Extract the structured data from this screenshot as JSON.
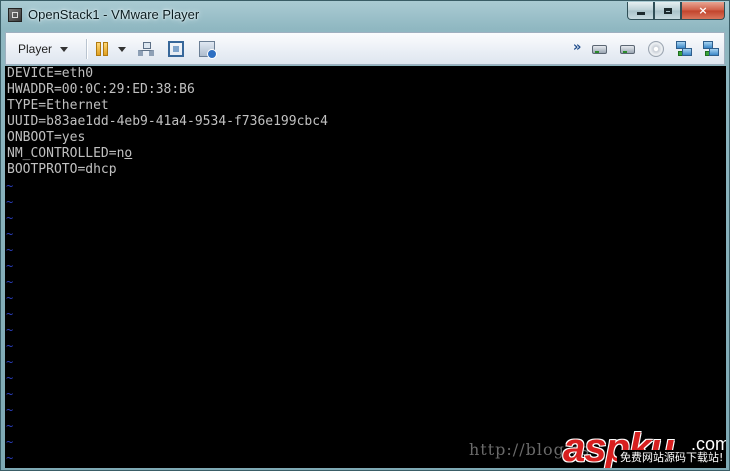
{
  "window": {
    "title": "OpenStack1 - VMware Player",
    "app_icon": "vmware-player-icon",
    "controls": {
      "minimize": "minimize-icon",
      "maximize": "maximize-icon",
      "close": "×"
    }
  },
  "toolbar": {
    "player_menu_label": "Player",
    "more_chevron": "»",
    "icons": [
      "pause-icon",
      "network-icon",
      "fullscreen-icon",
      "unity-icon",
      "hard-disk-icon",
      "hard-disk-icon",
      "cd-dvd-icon",
      "network-adapter-icon",
      "network-adapter-icon"
    ]
  },
  "console": {
    "text_color": "#c0c0c0",
    "tilde_color": "#2a3fbf",
    "lines": [
      "DEVICE=eth0",
      "HWADDR=00:0C:29:ED:38:B6",
      "TYPE=Ethernet",
      "UUID=b83ae1dd-4eb9-41a4-9534-f736e199cbc4",
      "ONBOOT=yes",
      "NM_CONTROLLED=no",
      "BOOTPROTO=dhcp"
    ],
    "tilde": "~"
  },
  "watermark": {
    "url": "http://blog.cs",
    "logo": "aspku",
    "logo_suffix": ".com",
    "tagline": "免费网站源码下载站!"
  }
}
